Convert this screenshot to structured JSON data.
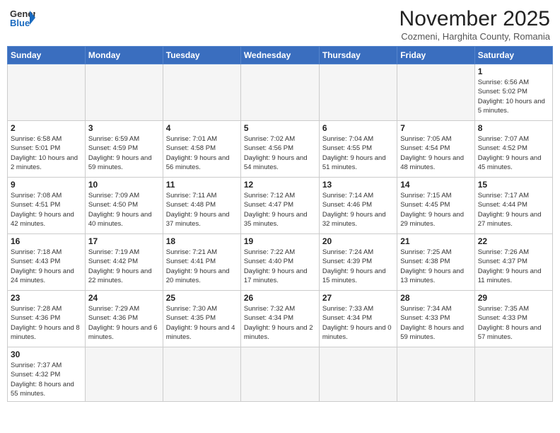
{
  "logo": {
    "general": "General",
    "blue": "Blue"
  },
  "header": {
    "month": "November 2025",
    "location": "Cozmeni, Harghita County, Romania"
  },
  "weekdays": [
    "Sunday",
    "Monday",
    "Tuesday",
    "Wednesday",
    "Thursday",
    "Friday",
    "Saturday"
  ],
  "weeks": [
    [
      {
        "day": "",
        "info": ""
      },
      {
        "day": "",
        "info": ""
      },
      {
        "day": "",
        "info": ""
      },
      {
        "day": "",
        "info": ""
      },
      {
        "day": "",
        "info": ""
      },
      {
        "day": "",
        "info": ""
      },
      {
        "day": "1",
        "info": "Sunrise: 6:56 AM\nSunset: 5:02 PM\nDaylight: 10 hours and 5 minutes."
      }
    ],
    [
      {
        "day": "2",
        "info": "Sunrise: 6:58 AM\nSunset: 5:01 PM\nDaylight: 10 hours and 2 minutes."
      },
      {
        "day": "3",
        "info": "Sunrise: 6:59 AM\nSunset: 4:59 PM\nDaylight: 9 hours and 59 minutes."
      },
      {
        "day": "4",
        "info": "Sunrise: 7:01 AM\nSunset: 4:58 PM\nDaylight: 9 hours and 56 minutes."
      },
      {
        "day": "5",
        "info": "Sunrise: 7:02 AM\nSunset: 4:56 PM\nDaylight: 9 hours and 54 minutes."
      },
      {
        "day": "6",
        "info": "Sunrise: 7:04 AM\nSunset: 4:55 PM\nDaylight: 9 hours and 51 minutes."
      },
      {
        "day": "7",
        "info": "Sunrise: 7:05 AM\nSunset: 4:54 PM\nDaylight: 9 hours and 48 minutes."
      },
      {
        "day": "8",
        "info": "Sunrise: 7:07 AM\nSunset: 4:52 PM\nDaylight: 9 hours and 45 minutes."
      }
    ],
    [
      {
        "day": "9",
        "info": "Sunrise: 7:08 AM\nSunset: 4:51 PM\nDaylight: 9 hours and 42 minutes."
      },
      {
        "day": "10",
        "info": "Sunrise: 7:09 AM\nSunset: 4:50 PM\nDaylight: 9 hours and 40 minutes."
      },
      {
        "day": "11",
        "info": "Sunrise: 7:11 AM\nSunset: 4:48 PM\nDaylight: 9 hours and 37 minutes."
      },
      {
        "day": "12",
        "info": "Sunrise: 7:12 AM\nSunset: 4:47 PM\nDaylight: 9 hours and 35 minutes."
      },
      {
        "day": "13",
        "info": "Sunrise: 7:14 AM\nSunset: 4:46 PM\nDaylight: 9 hours and 32 minutes."
      },
      {
        "day": "14",
        "info": "Sunrise: 7:15 AM\nSunset: 4:45 PM\nDaylight: 9 hours and 29 minutes."
      },
      {
        "day": "15",
        "info": "Sunrise: 7:17 AM\nSunset: 4:44 PM\nDaylight: 9 hours and 27 minutes."
      }
    ],
    [
      {
        "day": "16",
        "info": "Sunrise: 7:18 AM\nSunset: 4:43 PM\nDaylight: 9 hours and 24 minutes."
      },
      {
        "day": "17",
        "info": "Sunrise: 7:19 AM\nSunset: 4:42 PM\nDaylight: 9 hours and 22 minutes."
      },
      {
        "day": "18",
        "info": "Sunrise: 7:21 AM\nSunset: 4:41 PM\nDaylight: 9 hours and 20 minutes."
      },
      {
        "day": "19",
        "info": "Sunrise: 7:22 AM\nSunset: 4:40 PM\nDaylight: 9 hours and 17 minutes."
      },
      {
        "day": "20",
        "info": "Sunrise: 7:24 AM\nSunset: 4:39 PM\nDaylight: 9 hours and 15 minutes."
      },
      {
        "day": "21",
        "info": "Sunrise: 7:25 AM\nSunset: 4:38 PM\nDaylight: 9 hours and 13 minutes."
      },
      {
        "day": "22",
        "info": "Sunrise: 7:26 AM\nSunset: 4:37 PM\nDaylight: 9 hours and 11 minutes."
      }
    ],
    [
      {
        "day": "23",
        "info": "Sunrise: 7:28 AM\nSunset: 4:36 PM\nDaylight: 9 hours and 8 minutes."
      },
      {
        "day": "24",
        "info": "Sunrise: 7:29 AM\nSunset: 4:36 PM\nDaylight: 9 hours and 6 minutes."
      },
      {
        "day": "25",
        "info": "Sunrise: 7:30 AM\nSunset: 4:35 PM\nDaylight: 9 hours and 4 minutes."
      },
      {
        "day": "26",
        "info": "Sunrise: 7:32 AM\nSunset: 4:34 PM\nDaylight: 9 hours and 2 minutes."
      },
      {
        "day": "27",
        "info": "Sunrise: 7:33 AM\nSunset: 4:34 PM\nDaylight: 9 hours and 0 minutes."
      },
      {
        "day": "28",
        "info": "Sunrise: 7:34 AM\nSunset: 4:33 PM\nDaylight: 8 hours and 59 minutes."
      },
      {
        "day": "29",
        "info": "Sunrise: 7:35 AM\nSunset: 4:33 PM\nDaylight: 8 hours and 57 minutes."
      }
    ],
    [
      {
        "day": "30",
        "info": "Sunrise: 7:37 AM\nSunset: 4:32 PM\nDaylight: 8 hours and 55 minutes."
      },
      {
        "day": "",
        "info": ""
      },
      {
        "day": "",
        "info": ""
      },
      {
        "day": "",
        "info": ""
      },
      {
        "day": "",
        "info": ""
      },
      {
        "day": "",
        "info": ""
      },
      {
        "day": "",
        "info": ""
      }
    ]
  ]
}
